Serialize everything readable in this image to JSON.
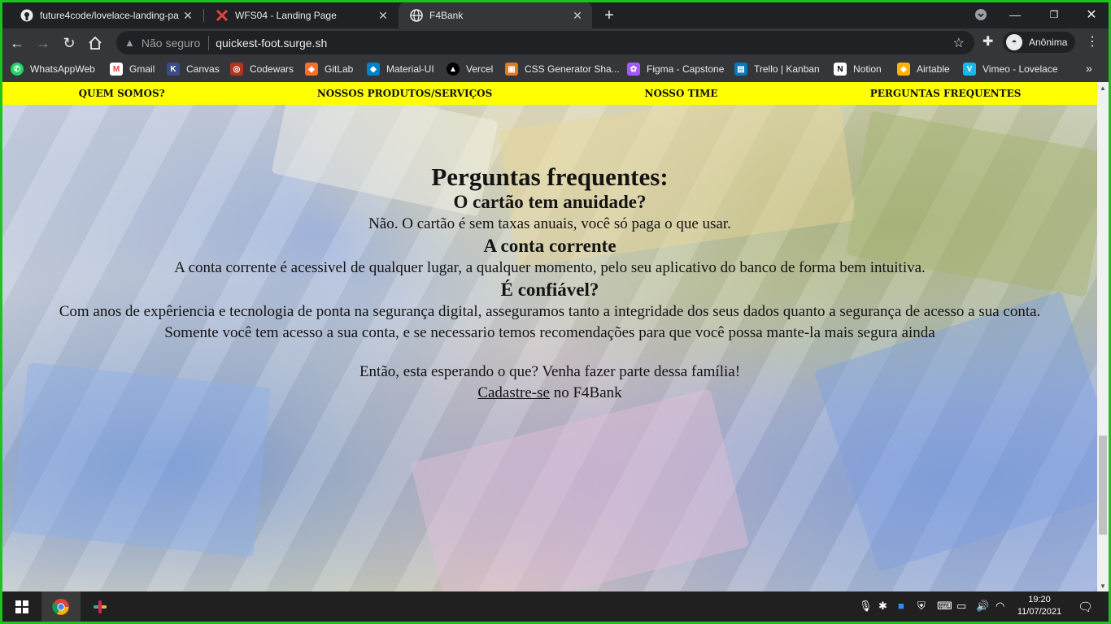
{
  "browser": {
    "tabs": [
      {
        "title": "future4code/lovelace-landing-pa",
        "icon": "github-icon",
        "active": false
      },
      {
        "title": "WFS04 - Landing Page",
        "icon": "labenu-icon",
        "active": false
      },
      {
        "title": "F4Bank",
        "icon": "globe-icon",
        "active": true
      }
    ],
    "security_label": "Não seguro",
    "url": "quickest-foot.surge.sh",
    "profile_name": "Anônima",
    "bookmarks": [
      {
        "label": "WhatsAppWeb",
        "color": "#25d366",
        "glyph": "✆"
      },
      {
        "label": "Gmail",
        "color": "#ea4335",
        "glyph": "M"
      },
      {
        "label": "Canvas",
        "color": "#394b88",
        "glyph": "K"
      },
      {
        "label": "Codewars",
        "color": "#b1361e",
        "glyph": "◎"
      },
      {
        "label": "GitLab",
        "color": "#fc6d26",
        "glyph": "🦊"
      },
      {
        "label": "Material-UI",
        "color": "#0081cb",
        "glyph": "◆"
      },
      {
        "label": "Vercel",
        "color": "#000000",
        "glyph": "▲"
      },
      {
        "label": "CSS Generator Sha...",
        "color": "#e07a1f",
        "glyph": "▣"
      },
      {
        "label": "Figma - Capstone",
        "color": "#a259ff",
        "glyph": "✿"
      },
      {
        "label": "Trello | Kanban",
        "color": "#0079bf",
        "glyph": "▤"
      },
      {
        "label": "Notion",
        "color": "#ffffff",
        "glyph": "N"
      },
      {
        "label": "Airtable",
        "color": "#fcb400",
        "glyph": "◈"
      },
      {
        "label": "Vimeo - Lovelace",
        "color": "#1ab7ea",
        "glyph": "V"
      }
    ]
  },
  "page": {
    "nav": [
      "QUEM SOMOS?",
      "NOSSOS PRODUTOS/SERVIÇOS",
      "NOSSO TIME",
      "PERGUNTAS FREQUENTES"
    ],
    "faq": {
      "title": "Perguntas frequentes:",
      "items": [
        {
          "q": "O cartão tem anuidade?",
          "a": "Não. O cartão é sem taxas anuais, você só paga o que usar."
        },
        {
          "q": "A conta corrente",
          "a": "A conta corrente é acessivel de qualquer lugar, a qualquer momento, pelo seu aplicativo do banco de forma bem intuitiva."
        },
        {
          "q": "É confiável?",
          "a": "Com anos de expêriencia e tecnologia de ponta na segurança digital, asseguramos tanto a integridade dos seus dados quanto a segurança de acesso a sua conta."
        }
      ],
      "extra": "Somente você tem acesso a sua conta, e se necessario temos recomendações para que você possa mante-la mais segura ainda",
      "cta_text": "Então, esta esperando o que? Venha fazer parte dessa família!",
      "cta_link": "Cadastre-se",
      "cta_suffix": " no F4Bank"
    }
  },
  "taskbar": {
    "time": "19:20",
    "date": "11/07/2021"
  }
}
